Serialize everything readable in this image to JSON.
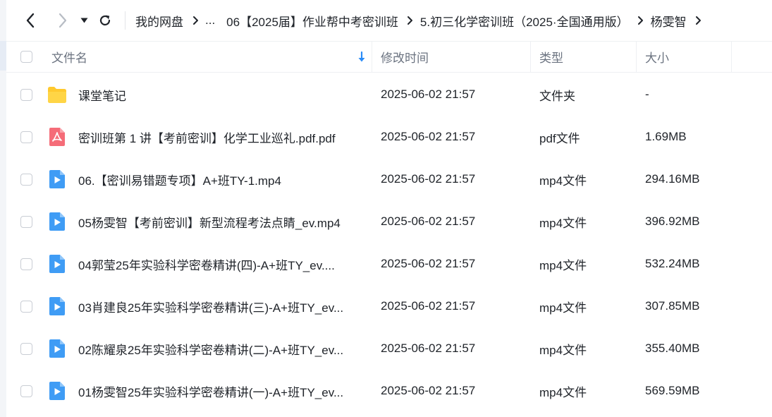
{
  "nav": {
    "breadcrumbs": [
      "我的网盘",
      "...",
      "06【2025届】作业帮中考密训班",
      "5.初三化学密训班（2025·全国通用版）",
      "杨雯智"
    ]
  },
  "columns": {
    "name": "文件名",
    "modified": "修改时间",
    "type": "类型",
    "size": "大小"
  },
  "colors": {
    "folder": "#ffc92e",
    "pdf": "#f56c78",
    "video": "#3f9cf5",
    "sort_arrow": "#2b8cf7"
  },
  "files": [
    {
      "icon": "folder-icon",
      "name": "课堂笔记",
      "modified": "2025-06-02 21:57",
      "type": "文件夹",
      "size": "-"
    },
    {
      "icon": "pdf-icon",
      "name": "密训班第 1 讲【考前密训】化学工业巡礼.pdf.pdf",
      "modified": "2025-06-02 21:57",
      "type": "pdf文件",
      "size": "1.69MB"
    },
    {
      "icon": "video-icon",
      "name": "06.【密训易错题专项】A+班TY-1.mp4",
      "modified": "2025-06-02 21:57",
      "type": "mp4文件",
      "size": "294.16MB"
    },
    {
      "icon": "video-icon",
      "name": "05杨雯智【考前密训】新型流程考法点睛_ev.mp4",
      "modified": "2025-06-02 21:57",
      "type": "mp4文件",
      "size": "396.92MB"
    },
    {
      "icon": "video-icon",
      "name": "04郭莹25年实验科学密卷精讲(四)-A+班TY_ev....",
      "modified": "2025-06-02 21:57",
      "type": "mp4文件",
      "size": "532.24MB"
    },
    {
      "icon": "video-icon",
      "name": "03肖建良25年实验科学密卷精讲(三)-A+班TY_ev...",
      "modified": "2025-06-02 21:57",
      "type": "mp4文件",
      "size": "307.85MB"
    },
    {
      "icon": "video-icon",
      "name": "02陈耀泉25年实验科学密卷精讲(二)-A+班TY_ev...",
      "modified": "2025-06-02 21:57",
      "type": "mp4文件",
      "size": "355.40MB"
    },
    {
      "icon": "video-icon",
      "name": "01杨雯智25年实验科学密卷精讲(一)-A+班TY_ev...",
      "modified": "2025-06-02 21:57",
      "type": "mp4文件",
      "size": "569.59MB"
    }
  ]
}
